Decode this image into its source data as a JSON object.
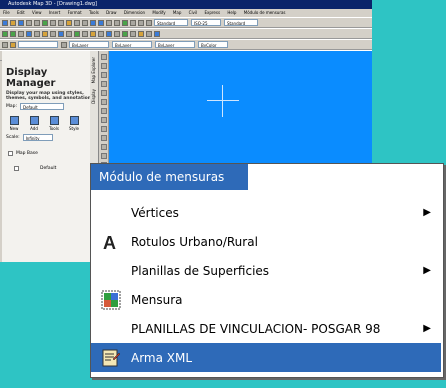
{
  "app": {
    "title": "Autodesk Map 3D - [Drawing1.dwg]",
    "menubar": [
      "File",
      "Edit",
      "View",
      "Insert",
      "Format",
      "Tools",
      "Draw",
      "Dimension",
      "Modify",
      "Map",
      "Civil",
      "Express",
      "Help",
      "Módulo de mensuras"
    ],
    "toolbar_combos": [
      "Standard",
      "ISO-25",
      "Standard",
      "ByLayer",
      "ByLayer",
      "ByLayer",
      "ByColor"
    ]
  },
  "display_manager": {
    "title": "Display Manager",
    "description": "Display your map using styles, themes, symbols, and annotation.",
    "map_label": "Map:",
    "map_value": "Default",
    "tools": [
      "New",
      "Add",
      "Tools",
      "Style",
      "Remove"
    ],
    "scale_label": "Scale:",
    "scale_value": "Infinity",
    "tree_root": "Map Base",
    "tree_child": "Default",
    "tab_tasks": "Map Explorer",
    "tab_display": "Display"
  },
  "menu": {
    "header": "Módulo de mensuras",
    "items": [
      {
        "label": "Vértices",
        "submenu": true,
        "icon": ""
      },
      {
        "label": "Rotulos Urbano/Rural",
        "submenu": false,
        "icon": "letter-a-icon"
      },
      {
        "label": "Planillas de Superficies",
        "submenu": true,
        "icon": ""
      },
      {
        "label": "Mensura",
        "submenu": false,
        "icon": "survey-icon"
      },
      {
        "label": "PLANILLAS DE VINCULACION- POSGAR 98",
        "submenu": true,
        "icon": ""
      },
      {
        "label": "Arma XML",
        "submenu": false,
        "icon": "xml-icon",
        "selected": true
      }
    ]
  },
  "colors": {
    "background": "#2ec4c4",
    "canvas": "#0a8cff",
    "highlight": "#2e6ab8"
  }
}
